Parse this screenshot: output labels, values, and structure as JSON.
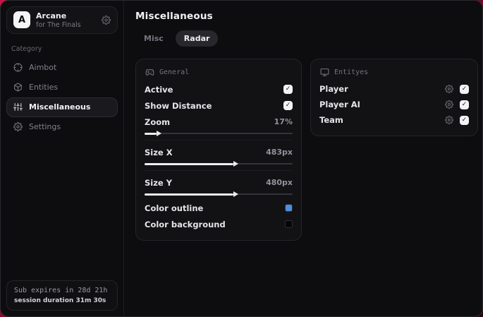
{
  "sidebar": {
    "logo_initial": "A",
    "app_title": "Arcane",
    "app_subtitle": "for The Finals",
    "category_label": "Category",
    "items": [
      {
        "label": "Aimbot",
        "icon": "crosshair-icon",
        "active": false
      },
      {
        "label": "Entities",
        "icon": "box-icon",
        "active": false
      },
      {
        "label": "Miscellaneous",
        "icon": "sliders-icon",
        "active": true
      },
      {
        "label": "Settings",
        "icon": "gear-icon",
        "active": false
      }
    ],
    "subscription": {
      "expires": "Sub expires in 28d 21h",
      "session": "session duration 31m 30s"
    }
  },
  "main": {
    "page_title": "Miscellaneous",
    "tabs": [
      {
        "label": "Misc",
        "active": false
      },
      {
        "label": "Radar",
        "active": true
      }
    ],
    "panels": {
      "general": {
        "title": "General",
        "icon": "gamepad-icon",
        "toggles": [
          {
            "label": "Active",
            "checked": true
          },
          {
            "label": "Show Distance",
            "checked": true
          }
        ],
        "sliders": [
          {
            "label": "Zoom",
            "value": "17%",
            "fill_pct": 8
          },
          {
            "label": "Size X",
            "value": "483px",
            "fill_pct": 60
          },
          {
            "label": "Size Y",
            "value": "480px",
            "fill_pct": 60
          }
        ],
        "colors": [
          {
            "label": "Color outline",
            "hex": "#4e8ede"
          },
          {
            "label": "Color background",
            "hex": "#050505"
          }
        ]
      },
      "entities": {
        "title": "Entityes",
        "icon": "monitor-icon",
        "rows": [
          {
            "label": "Player",
            "checked": true
          },
          {
            "label": "Player AI",
            "checked": true
          },
          {
            "label": "Team",
            "checked": true
          }
        ]
      }
    }
  },
  "glyphs": {
    "check": "✓"
  },
  "colors": {
    "accent_blue": "#4e8ede",
    "swatch_black": "#050505"
  }
}
